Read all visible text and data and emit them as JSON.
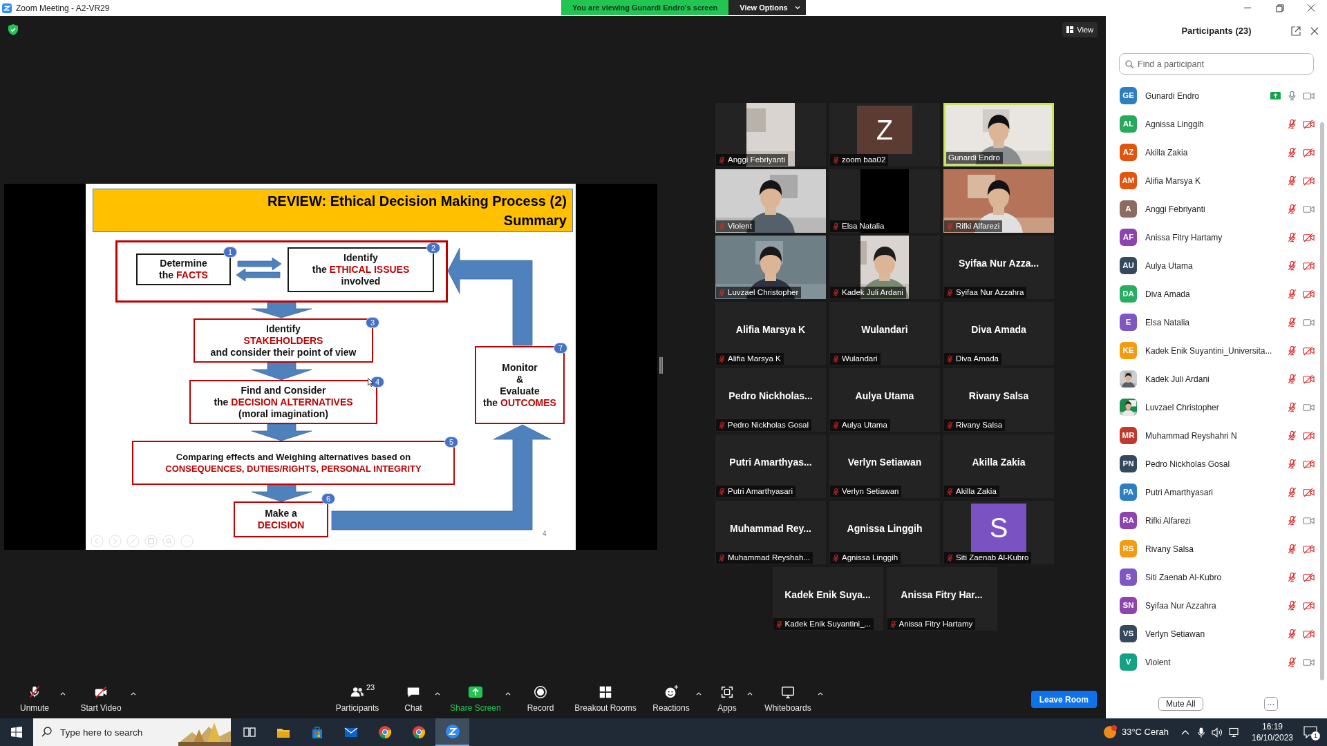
{
  "window": {
    "title": "Zoom Meeting - A2-VR29"
  },
  "banner": {
    "text": "You are viewing Gunardi Endro's screen",
    "button": "View Options"
  },
  "view_button": "View",
  "slide": {
    "title": "REVIEW: Ethical Decision Making Process (2)",
    "subtitle": "Summary",
    "page": "4",
    "steps": [
      {
        "number": "1",
        "lines": [
          [
            {
              "text": "Determine",
              "highlight": false
            }
          ],
          [
            {
              "text": "the ",
              "highlight": false
            },
            {
              "text": "FACTS",
              "highlight": true
            }
          ]
        ]
      },
      {
        "number": "2",
        "lines": [
          [
            {
              "text": "Identify",
              "highlight": false
            }
          ],
          [
            {
              "text": "the ",
              "highlight": false
            },
            {
              "text": "ETHICAL ISSUES",
              "highlight": true
            }
          ],
          [
            {
              "text": "involved",
              "highlight": false
            }
          ]
        ]
      },
      {
        "number": "3",
        "lines": [
          [
            {
              "text": "Identify",
              "highlight": false
            }
          ],
          [
            {
              "text": "STAKEHOLDERS",
              "highlight": true
            }
          ],
          [
            {
              "text": "and consider their point of view",
              "highlight": false
            }
          ]
        ]
      },
      {
        "number": "4",
        "lines": [
          [
            {
              "text": "Find and Consider",
              "highlight": false
            }
          ],
          [
            {
              "text": "the ",
              "highlight": false
            },
            {
              "text": "DECISION ALTERNATIVES",
              "highlight": true
            }
          ],
          [
            {
              "text": "(moral imagination)",
              "highlight": false
            }
          ]
        ]
      },
      {
        "number": "5",
        "lines": [
          [
            {
              "text": "Comparing effects and Weighing alternatives based on",
              "highlight": false
            }
          ],
          [
            {
              "text": "CONSEQUENCES, DUTIES/RIGHTS, PERSONAL INTEGRITY",
              "highlight": true
            }
          ]
        ]
      },
      {
        "number": "6",
        "lines": [
          [
            {
              "text": "Make a",
              "highlight": false
            }
          ],
          [
            {
              "text": "DECISION",
              "highlight": true
            }
          ]
        ]
      },
      {
        "number": "7",
        "lines": [
          [
            {
              "text": "Monitor",
              "highlight": false
            }
          ],
          [
            {
              "text": "&",
              "highlight": false
            }
          ],
          [
            {
              "text": "Evaluate",
              "highlight": false
            }
          ],
          [
            {
              "text": "the ",
              "highlight": false
            },
            {
              "text": "OUTCOMES",
              "highlight": true
            }
          ]
        ]
      }
    ]
  },
  "tiles": [
    {
      "kind": "portrait",
      "label": "Anggi Febriyanti",
      "muted": true,
      "highlighted": false
    },
    {
      "kind": "avatar",
      "initial": "Z",
      "color": "#5b3b32",
      "label": "zoom baa02",
      "muted": true,
      "highlighted": false
    },
    {
      "kind": "video",
      "label": "Gunardi Endro",
      "muted": false,
      "highlighted": true
    },
    {
      "kind": "video",
      "label": "Violent",
      "muted": true,
      "highlighted": false
    },
    {
      "kind": "black",
      "label": "Elsa Natalia",
      "muted": true,
      "highlighted": false
    },
    {
      "kind": "video",
      "label": "Rifki Alfarezi",
      "muted": true,
      "highlighted": false
    },
    {
      "kind": "video",
      "label": "Luvzael Christopher",
      "muted": true,
      "highlighted": false
    },
    {
      "kind": "portrait",
      "label": "Kadek Juli Ardani",
      "muted": true,
      "highlighted": false
    },
    {
      "kind": "name",
      "display_name": "Syifaa Nur Azza...",
      "label": "Syifaa Nur Azzahra",
      "muted": true,
      "highlighted": false
    },
    {
      "kind": "name",
      "display_name": "Alifia Marsya K",
      "label": "Alifia Marsya K",
      "muted": true,
      "highlighted": false
    },
    {
      "kind": "name",
      "display_name": "Wulandari",
      "label": "Wulandari",
      "muted": true,
      "highlighted": false
    },
    {
      "kind": "name",
      "display_name": "Diva Amada",
      "label": "Diva Amada",
      "muted": true,
      "highlighted": false
    },
    {
      "kind": "name",
      "display_name": "Pedro Nickholas...",
      "label": "Pedro Nickholas Gosal",
      "muted": true,
      "highlighted": false
    },
    {
      "kind": "name",
      "display_name": "Aulya Utama",
      "label": "Aulya Utama",
      "muted": true,
      "highlighted": false
    },
    {
      "kind": "name",
      "display_name": "Rivany Salsa",
      "label": "Rivany Salsa",
      "muted": true,
      "highlighted": false
    },
    {
      "kind": "name",
      "display_name": "Putri Amarthyas...",
      "label": "Putri Amarthyasari",
      "muted": true,
      "highlighted": false
    },
    {
      "kind": "name",
      "display_name": "Verlyn Setiawan",
      "label": "Verlyn Setiawan",
      "muted": true,
      "highlighted": false
    },
    {
      "kind": "name",
      "display_name": "Akilla Zakia",
      "label": "Akilla Zakia",
      "muted": true,
      "highlighted": false
    },
    {
      "kind": "name",
      "display_name": "Muhammad Rey...",
      "label": "Muhammad Reyshah...",
      "muted": true,
      "highlighted": false
    },
    {
      "kind": "name",
      "display_name": "Agnissa Linggih",
      "label": "Agnissa Linggih",
      "muted": true,
      "highlighted": false
    },
    {
      "kind": "avatar",
      "initial": "S",
      "color": "#7b52c1",
      "label": "Siti Zaenab Al-Kubro",
      "muted": true,
      "highlighted": false
    },
    {
      "kind": "name",
      "display_name": "Kadek Enik Suya...",
      "label": "Kadek Enik Suyantini_...",
      "muted": true,
      "highlighted": false
    },
    {
      "kind": "name",
      "display_name": "Anissa Fitry Har...",
      "label": "Anissa Fitry Hartamy",
      "muted": true,
      "highlighted": false
    }
  ],
  "toolbar": [
    {
      "kind": "mic",
      "label": "Unmute",
      "caret": true
    },
    {
      "kind": "video",
      "label": "Start Video",
      "caret": true
    },
    {
      "kind": "participants",
      "label": "Participants",
      "count": "23",
      "caret": false
    },
    {
      "kind": "chat",
      "label": "Chat",
      "caret": true
    },
    {
      "kind": "share",
      "label": "Share Screen",
      "caret": true
    },
    {
      "kind": "record",
      "label": "Record",
      "caret": false
    },
    {
      "kind": "breakout",
      "label": "Breakout Rooms",
      "caret": false
    },
    {
      "kind": "reactions",
      "label": "Reactions",
      "caret": true
    },
    {
      "kind": "apps",
      "label": "Apps",
      "caret": true
    },
    {
      "kind": "whiteboards",
      "label": "Whiteboards",
      "caret": true
    }
  ],
  "leave_button": "Leave Room",
  "panel": {
    "title": "Participants (23)",
    "search": {
      "placeholder": "Find a participant"
    },
    "mute_all": "Mute All",
    "more": "···",
    "participants": [
      {
        "kind": "initials",
        "initials": "GE",
        "color": "#2d7fc1",
        "name": "Gunardi Endro",
        "sharing": true,
        "mic_muted": false,
        "video_off": false
      },
      {
        "kind": "initials",
        "initials": "AL",
        "color": "#27a85a",
        "name": "Agnissa Linggih",
        "sharing": false,
        "mic_muted": true,
        "video_off": true
      },
      {
        "kind": "initials",
        "initials": "AZ",
        "color": "#e0560f",
        "name": "Akilla Zakia",
        "sharing": false,
        "mic_muted": true,
        "video_off": true
      },
      {
        "kind": "initials",
        "initials": "AM",
        "color": "#e0560f",
        "name": "Alifia Marsya K",
        "sharing": false,
        "mic_muted": true,
        "video_off": true
      },
      {
        "kind": "initials",
        "initials": "A",
        "color": "#8c6b60",
        "name": "Anggi Febriyanti",
        "sharing": false,
        "mic_muted": true,
        "video_off": false
      },
      {
        "kind": "initials",
        "initials": "AF",
        "color": "#8e44ad",
        "name": "Anissa Fitry Hartamy",
        "sharing": false,
        "mic_muted": true,
        "video_off": true
      },
      {
        "kind": "initials",
        "initials": "AU",
        "color": "#34495e",
        "name": "Aulya Utama",
        "sharing": false,
        "mic_muted": true,
        "video_off": true
      },
      {
        "kind": "initials",
        "initials": "DA",
        "color": "#27ae60",
        "name": "Diva Amada",
        "sharing": false,
        "mic_muted": true,
        "video_off": true
      },
      {
        "kind": "initials",
        "initials": "E",
        "color": "#7e57c2",
        "name": "Elsa Natalia",
        "sharing": false,
        "mic_muted": true,
        "video_off": false
      },
      {
        "kind": "initials",
        "initials": "KE",
        "color": "#f39c12",
        "name": "Kadek Enik Suyantini_Universita...",
        "sharing": false,
        "mic_muted": true,
        "video_off": true
      },
      {
        "name": "Kadek Juli Ardani",
        "sharing": false,
        "mic_muted": true,
        "video_off": true
      },
      {
        "name": "Luvzael Christopher",
        "sharing": false,
        "mic_muted": true,
        "video_off": false
      },
      {
        "kind": "initials",
        "initials": "MR",
        "color": "#c0392b",
        "name": "Muhammad Reyshahri N",
        "sharing": false,
        "mic_muted": true,
        "video_off": true
      },
      {
        "kind": "initials",
        "initials": "PN",
        "color": "#34495e",
        "name": "Pedro Nickholas Gosal",
        "sharing": false,
        "mic_muted": true,
        "video_off": true
      },
      {
        "kind": "initials",
        "initials": "PA",
        "color": "#2d7fc1",
        "name": "Putri Amarthyasari",
        "sharing": false,
        "mic_muted": true,
        "video_off": true
      },
      {
        "kind": "initials",
        "initials": "RA",
        "color": "#8e44ad",
        "name": "Rifki Alfarezi",
        "sharing": false,
        "mic_muted": true,
        "video_off": false
      },
      {
        "kind": "initials",
        "initials": "RS",
        "color": "#f39c12",
        "name": "Rivany Salsa",
        "sharing": false,
        "mic_muted": true,
        "video_off": true
      },
      {
        "kind": "initials",
        "initials": "S",
        "color": "#7e57c2",
        "name": "Siti Zaenab Al-Kubro",
        "sharing": false,
        "mic_muted": true,
        "video_off": true
      },
      {
        "kind": "initials",
        "initials": "SN",
        "color": "#8e44ad",
        "name": "Syifaa Nur Azzahra",
        "sharing": false,
        "mic_muted": true,
        "video_off": true
      },
      {
        "kind": "initials",
        "initials": "VS",
        "color": "#34495e",
        "name": "Verlyn Setiawan",
        "sharing": false,
        "mic_muted": true,
        "video_off": true
      },
      {
        "kind": "initials",
        "initials": "V",
        "color": "#16a085",
        "name": "Violent",
        "sharing": false,
        "mic_muted": true,
        "video_off": false
      }
    ]
  },
  "taskbar": {
    "search": {
      "placeholder": "Type here to search"
    },
    "apps": [
      {
        "kind": "taskview",
        "selected": false
      },
      {
        "kind": "explorer",
        "selected": false
      },
      {
        "kind": "store",
        "selected": false
      },
      {
        "kind": "mail",
        "selected": false
      },
      {
        "kind": "chrome",
        "selected": false
      },
      {
        "kind": "chrome",
        "selected": false
      },
      {
        "kind": "zoom",
        "selected": true
      }
    ],
    "weather": "33°C Cerah",
    "time": "16:19",
    "date": "16/10/2023",
    "notifications": "1"
  }
}
